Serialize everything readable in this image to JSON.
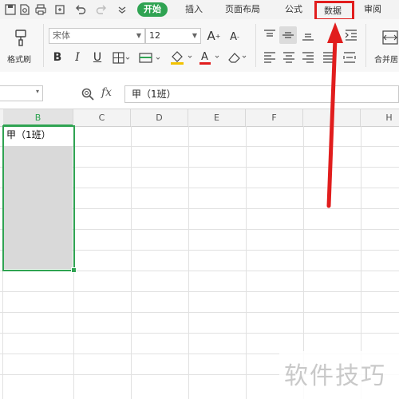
{
  "menu": {
    "tabs": [
      "开始",
      "插入",
      "页面布局",
      "公式",
      "数据",
      "审阅"
    ],
    "active_tab": "开始",
    "highlighted_tab": "数据"
  },
  "ribbon": {
    "format_painter_label": "格式刷",
    "font_name": "宋体",
    "font_size": "12",
    "merge_label": "合并居"
  },
  "formula_bar": {
    "fx_label": "fx",
    "content": "甲（1班）"
  },
  "grid": {
    "columns": [
      "B",
      "C",
      "D",
      "E",
      "F",
      "H"
    ],
    "selected_column": "B",
    "active_cell_value": "甲（1班）"
  },
  "watermark": "软件技巧",
  "colors": {
    "accent_green": "#2fa352",
    "annotation_red": "#e11d1d"
  }
}
